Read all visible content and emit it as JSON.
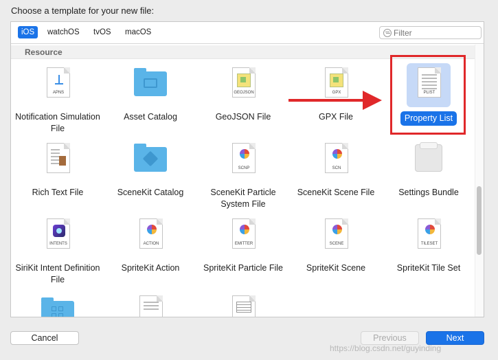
{
  "heading": "Choose a template for your new file:",
  "tabs": [
    {
      "label": "iOS",
      "active": true
    },
    {
      "label": "watchOS",
      "active": false
    },
    {
      "label": "tvOS",
      "active": false
    },
    {
      "label": "macOS",
      "active": false
    }
  ],
  "filter": {
    "placeholder": "Filter"
  },
  "section": {
    "title": "Resource"
  },
  "templates": [
    {
      "label": "Notification Simulation File",
      "icon": "apns-doc-icon",
      "tag": "APNS",
      "selected": false
    },
    {
      "label": "Asset Catalog",
      "icon": "folder-icon",
      "tag": "",
      "selected": false
    },
    {
      "label": "GeoJSON File",
      "icon": "geojson-doc-icon",
      "tag": "GEOJSON",
      "selected": false
    },
    {
      "label": "GPX File",
      "icon": "gpx-doc-icon",
      "tag": "GPX",
      "selected": false
    },
    {
      "label": "Property List",
      "icon": "plist-doc-icon",
      "tag": "PLIST",
      "selected": true
    },
    {
      "label": "Rich Text File",
      "icon": "rtf-doc-icon",
      "tag": "",
      "selected": false
    },
    {
      "label": "SceneKit Catalog",
      "icon": "scenekit-folder-icon",
      "tag": "",
      "selected": false
    },
    {
      "label": "SceneKit Particle System File",
      "icon": "scnp-doc-icon",
      "tag": "SCNP",
      "selected": false
    },
    {
      "label": "SceneKit Scene File",
      "icon": "scn-doc-icon",
      "tag": "SCN",
      "selected": false
    },
    {
      "label": "Settings Bundle",
      "icon": "settings-bundle-icon",
      "tag": "",
      "selected": false
    },
    {
      "label": "SiriKit Intent Definition File",
      "icon": "intents-doc-icon",
      "tag": "INTENTS",
      "selected": false
    },
    {
      "label": "SpriteKit Action",
      "icon": "action-doc-icon",
      "tag": "ACTION",
      "selected": false
    },
    {
      "label": "SpriteKit Particle File",
      "icon": "emitter-doc-icon",
      "tag": "EMITTER",
      "selected": false
    },
    {
      "label": "SpriteKit Scene",
      "icon": "scene-doc-icon",
      "tag": "SCENE",
      "selected": false
    },
    {
      "label": "SpriteKit Tile Set",
      "icon": "tileset-doc-icon",
      "tag": "TILESET",
      "selected": false
    }
  ],
  "buttons": {
    "cancel": "Cancel",
    "previous": "Previous",
    "next": "Next"
  },
  "watermark": "https://blog.csdn.net/guyinding",
  "colors": {
    "accent": "#1a73e8",
    "highlight": "#e0282a"
  }
}
